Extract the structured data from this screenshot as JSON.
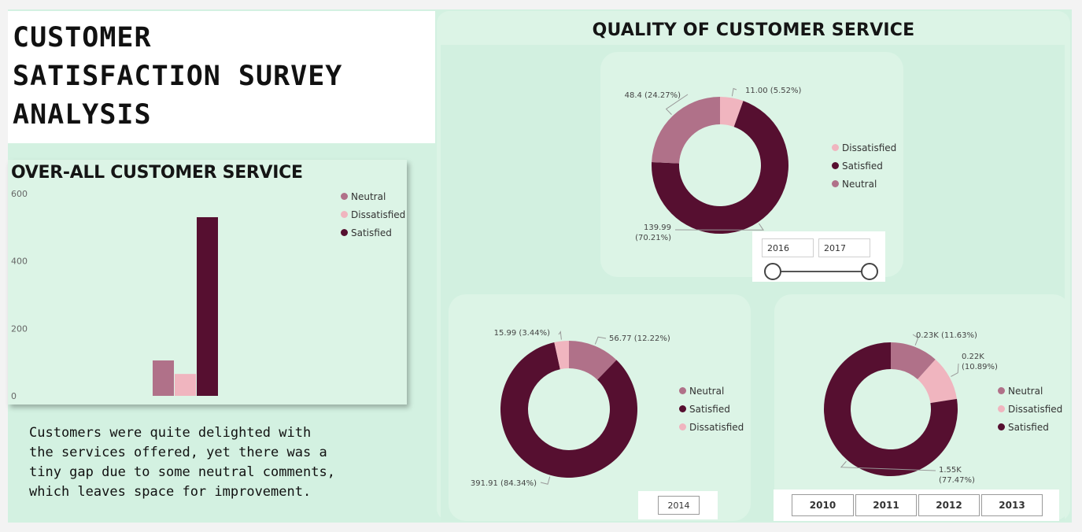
{
  "page_title": "CUSTOMER\nSATISFACTION SURVEY\nANALYSIS",
  "summary": "Customers were quite delighted with\nthe services offered, yet there was a\ntiny gap due to some neutral comments,\nwhich leaves space for improvement.",
  "colors": {
    "neutral": "#b07189",
    "dissatisfied": "#f0b5bf",
    "satisfied": "#560f30",
    "grid_text": "#666666"
  },
  "chart_data": [
    {
      "type": "bar",
      "title": "OVER-ALL CUSTOMER SERVICE",
      "categories": [
        "Neutral",
        "Dissatisfied",
        "Satisfied"
      ],
      "values": [
        105,
        65,
        530
      ],
      "ylim": [
        0,
        600
      ],
      "yticks": [
        "600",
        "400",
        "200",
        "0"
      ],
      "legend": [
        "Neutral",
        "Dissatisfied",
        "Satisfied"
      ],
      "legend_position": "top-right"
    },
    {
      "type": "pie",
      "title": "QUALITY OF CUSTOMER SERVICE",
      "slices": [
        {
          "name": "Dissatisfied",
          "value": 11.0,
          "label": "11.00 (5.52%)"
        },
        {
          "name": "Satisfied",
          "value": 139.99,
          "label": "139.99\n(70.21%)"
        },
        {
          "name": "Neutral",
          "value": 48.4,
          "label": "48.4 (24.27%)"
        }
      ],
      "legend": [
        "Dissatisfied",
        "Satisfied",
        "Neutral"
      ],
      "slicer": {
        "start": "2016",
        "end": "2017"
      }
    },
    {
      "type": "pie",
      "slices": [
        {
          "name": "Neutral",
          "value": 56.77,
          "label": "56.77 (12.22%)"
        },
        {
          "name": "Satisfied",
          "value": 391.91,
          "label": "391.91 (84.34%)"
        },
        {
          "name": "Dissatisfied",
          "value": 15.99,
          "label": "15.99 (3.44%)"
        }
      ],
      "legend": [
        "Neutral",
        "Satisfied",
        "Dissatisfied"
      ],
      "years": [
        "2014"
      ]
    },
    {
      "type": "pie",
      "slices": [
        {
          "name": "Neutral",
          "value": 0.2326,
          "label": "0.23K (11.63%)"
        },
        {
          "name": "Dissatisfied",
          "value": 0.2178,
          "label": "0.22K\n(10.89%)"
        },
        {
          "name": "Satisfied",
          "value": 1.5494,
          "label": "1.55K\n(77.47%)"
        }
      ],
      "legend": [
        "Neutral",
        "Dissatisfied",
        "Satisfied"
      ],
      "years": [
        "2010",
        "2011",
        "2012",
        "2013"
      ]
    }
  ]
}
